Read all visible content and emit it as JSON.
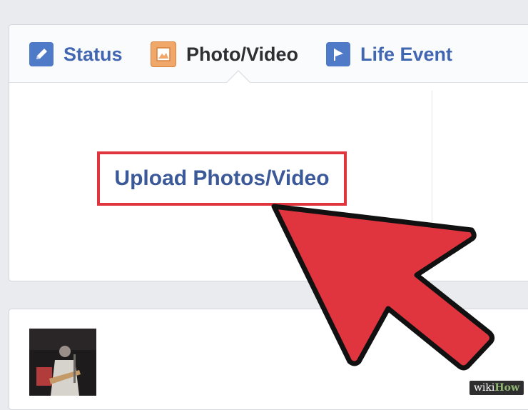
{
  "composer": {
    "tabs": [
      {
        "label": "Status",
        "icon": "pencil-icon"
      },
      {
        "label": "Photo/Video",
        "icon": "photo-icon"
      },
      {
        "label": "Life Event",
        "icon": "flag-icon"
      }
    ],
    "upload_label": "Upload Photos/Video"
  },
  "annotation": {
    "highlight_color": "#e0343f",
    "arrow_color": "#e0343f"
  },
  "watermark": {
    "part1": "wiki",
    "part2": "How"
  },
  "colors": {
    "link_blue": "#3b5998",
    "tab_blue": "#4267b2",
    "page_bg": "#e9ebee"
  }
}
